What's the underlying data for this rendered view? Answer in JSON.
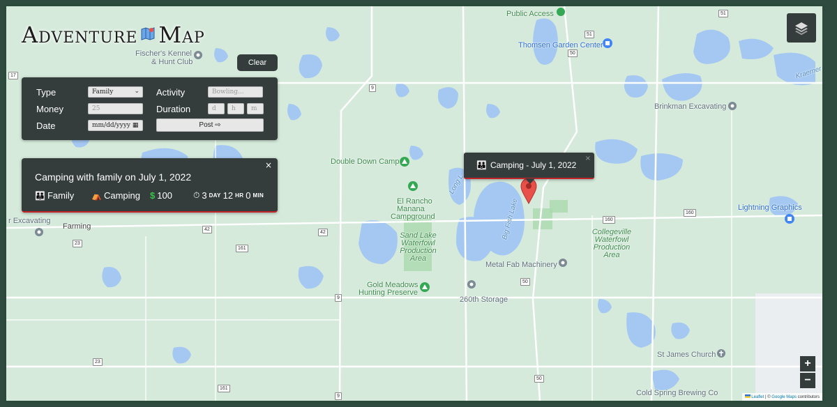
{
  "logo": {
    "word1": "Adventure",
    "word2": "Map"
  },
  "toolbar": {
    "clear_label": "Clear"
  },
  "filter": {
    "type_label": "Type",
    "type_value": "Family",
    "activity_label": "Activity",
    "activity_placeholder": "Bowling...",
    "money_label": "Money",
    "money_placeholder": "25",
    "duration_label": "Duration",
    "duration_d": "d",
    "duration_h": "h",
    "duration_m": "m",
    "date_label": "Date",
    "date_placeholder": "mm/dd/yyyy",
    "post_label": "Post ⇨"
  },
  "event_card": {
    "title": "Camping with family on July 1, 2022",
    "type": "Family",
    "activity": "Camping",
    "money": "100",
    "days": "3",
    "day_unit": "DAY",
    "hours": "12",
    "hour_unit": "HR",
    "minutes": "0",
    "minute_unit": "MIN",
    "close": "×"
  },
  "popup": {
    "text": "Camping - July 1, 2022",
    "close": "×"
  },
  "zoom": {
    "in": "+",
    "out": "−"
  },
  "attribution": {
    "leaflet": "Leaflet",
    "sep": " | © ",
    "google": "Google Maps",
    "rest": " contributors"
  },
  "map_labels": {
    "public_access": "Public Access",
    "thomsen": "Thomsen Garden Center",
    "fischers1": "Fischer's Kennel",
    "fischers2": "& Hunt Club",
    "brinkman": "Brinkman Excavating",
    "kraemer": "Kraemer",
    "double_down": "Double Down Camp",
    "el_rancho1": "El Rancho",
    "el_rancho2": "Manana",
    "el_rancho3": "Campground",
    "long_lake": "Long L",
    "big_fish": "Big Fish Lake",
    "lightning": "Lightning Graphics",
    "excavating": "r Excavating",
    "farming": "Farming",
    "sand_lake1": "Sand Lake",
    "sand_lake2": "Waterfowl",
    "sand_lake3": "Production",
    "sand_lake4": "Area",
    "collegeville1": "Collegeville",
    "collegeville2": "Waterfowl",
    "collegeville3": "Production",
    "collegeville4": "Area",
    "metal_fab": "Metal Fab Machinery",
    "gold_meadows1": "Gold Meadows",
    "gold_meadows2": "Hunting Preserve",
    "storage": "260th Storage",
    "st_james": "St James Church",
    "cold_spring": "Cold Spring Brewing Co"
  },
  "road_shields": [
    "51",
    "51",
    "50",
    "17",
    "9",
    "42",
    "42",
    "23",
    "161",
    "160",
    "160",
    "50",
    "9",
    "23",
    "161",
    "9",
    "50"
  ]
}
